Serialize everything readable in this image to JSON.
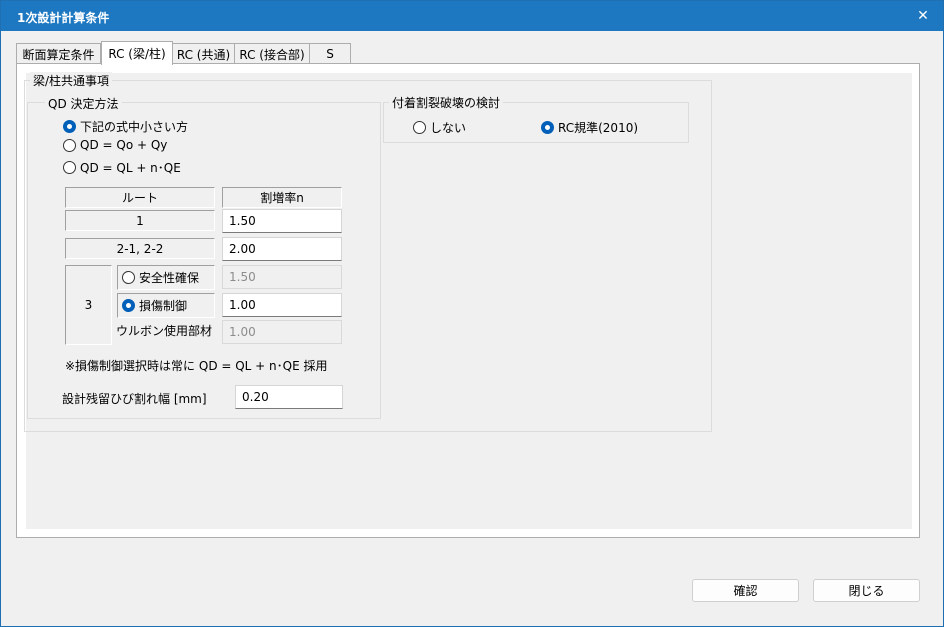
{
  "window": {
    "title": "1次設計計算条件",
    "close_glyph": "✕"
  },
  "tabs": [
    {
      "label": "断面算定条件",
      "active": false
    },
    {
      "label": "RC (梁/柱)",
      "active": true
    },
    {
      "label": "RC (共通)",
      "active": false
    },
    {
      "label": "RC (接合部)",
      "active": false
    },
    {
      "label": "S",
      "active": false
    }
  ],
  "common_group": {
    "title": "梁/柱共通事項",
    "qd_group": {
      "title": "QD 決定方法",
      "options": [
        {
          "label": "下記の式中小さい方",
          "checked": true
        },
        {
          "label": "QD = Qo + Qy",
          "checked": false
        },
        {
          "label": "QD = QL + n･QE",
          "checked": false
        }
      ],
      "table": {
        "header_route": "ルート",
        "header_rate": "割増率n",
        "row1_route": "1",
        "row1_value": "1.50",
        "row2_route": "2-1, 2-2",
        "row2_value": "2.00",
        "row3_route": "3",
        "safety_label": "安全性確保",
        "safety_checked": false,
        "safety_value": "1.50",
        "damage_label": "損傷制御",
        "damage_checked": true,
        "damage_value": "1.00",
        "urubon_label": "ウルボン使用部材",
        "urubon_value": "1.00"
      },
      "note": "※損傷制御選択時は常に QD = QL + n･QE 採用"
    },
    "crack_label": "設計残留ひび割れ幅 [mm]",
    "crack_value": "0.20"
  },
  "bond_group": {
    "title": "付着割裂破壊の検討",
    "options": [
      {
        "label": "しない",
        "checked": false
      },
      {
        "label": "RC規準(2010)",
        "checked": true
      }
    ]
  },
  "buttons": {
    "ok": "確認",
    "close": "閉じる"
  }
}
